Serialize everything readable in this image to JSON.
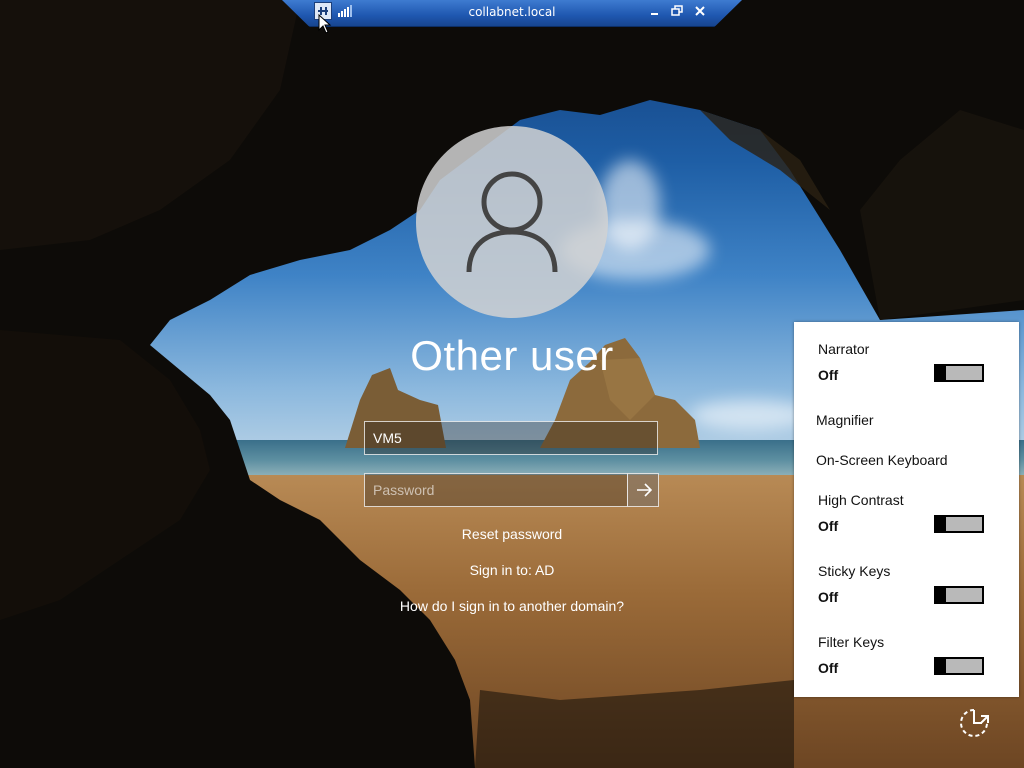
{
  "rdp_bar": {
    "title": "collabnet.local",
    "icons": [
      "pin-icon",
      "connection-quality-icon",
      "minimize-icon",
      "restore-icon",
      "close-icon"
    ]
  },
  "login": {
    "display_name": "Other user",
    "username_value": "VM5",
    "password_placeholder": "Password",
    "reset_password": "Reset password",
    "sign_in_to": "Sign in to: AD",
    "other_domain": "How do I sign in to another domain?",
    "icons": [
      "user-avatar-icon",
      "arrow-right-icon"
    ]
  },
  "ease_of_access": {
    "narrator": {
      "label": "Narrator",
      "state": "Off",
      "on": false
    },
    "magnifier": "Magnifier",
    "on_screen_keyboard": "On-Screen Keyboard",
    "high_contrast": {
      "label": "High Contrast",
      "state": "Off",
      "on": false
    },
    "sticky_keys": {
      "label": "Sticky Keys",
      "state": "Off",
      "on": false
    },
    "filter_keys": {
      "label": "Filter Keys",
      "state": "Off",
      "on": false
    },
    "button_icon": "ease-of-access-icon"
  },
  "colors": {
    "rdp_bar": "#1f57b0",
    "panel_bg": "#ffffff",
    "toggle_off": "#b9b9b9"
  }
}
